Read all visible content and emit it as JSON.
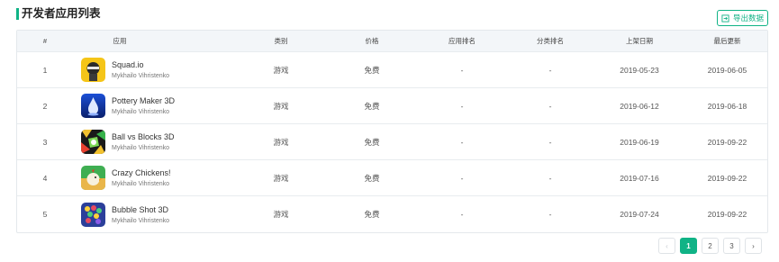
{
  "header": {
    "title": "开发者应用列表",
    "export_label": "导出数据",
    "accent_color": "#10b386"
  },
  "table": {
    "columns": [
      "#",
      "应用",
      "类别",
      "价格",
      "应用排名",
      "分类排名",
      "上架日期",
      "最后更新"
    ],
    "rows": [
      {
        "idx": "1",
        "name": "Squad.io",
        "developer": "Mykhailo Vihristenko",
        "category": "游戏",
        "price": "免费",
        "app_rank": "-",
        "category_rank": "-",
        "release_date": "2019-05-23",
        "last_update": "2019-06-05",
        "icon": "squad-io-icon"
      },
      {
        "idx": "2",
        "name": "Pottery Maker 3D",
        "developer": "Mykhailo Vihristenko",
        "category": "游戏",
        "price": "免费",
        "app_rank": "-",
        "category_rank": "-",
        "release_date": "2019-06-12",
        "last_update": "2019-06-18",
        "icon": "pottery-maker-icon"
      },
      {
        "idx": "3",
        "name": "Ball vs Blocks 3D",
        "developer": "Mykhailo Vihristenko",
        "category": "游戏",
        "price": "免费",
        "app_rank": "-",
        "category_rank": "-",
        "release_date": "2019-06-19",
        "last_update": "2019-09-22",
        "icon": "ball-vs-blocks-icon"
      },
      {
        "idx": "4",
        "name": "Crazy Chickens!",
        "developer": "Mykhailo Vihristenko",
        "category": "游戏",
        "price": "免费",
        "app_rank": "-",
        "category_rank": "-",
        "release_date": "2019-07-16",
        "last_update": "2019-09-22",
        "icon": "crazy-chickens-icon"
      },
      {
        "idx": "5",
        "name": "Bubble Shot 3D",
        "developer": "Mykhailo Vihristenko",
        "category": "游戏",
        "price": "免费",
        "app_rank": "-",
        "category_rank": "-",
        "release_date": "2019-07-24",
        "last_update": "2019-09-22",
        "icon": "bubble-shot-icon"
      }
    ]
  },
  "pagination": {
    "prev": "‹",
    "pages": [
      "1",
      "2",
      "3"
    ],
    "active_page": "1",
    "next": "›"
  }
}
